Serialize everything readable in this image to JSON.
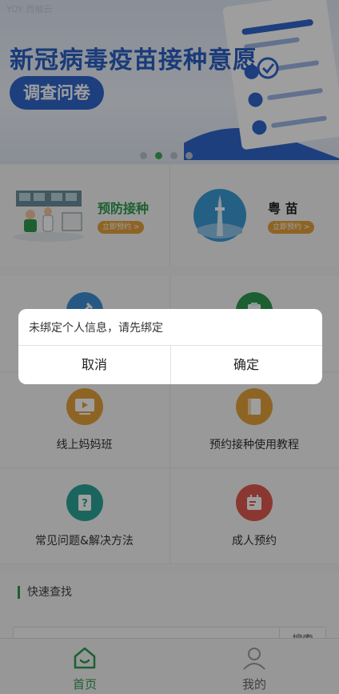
{
  "banner": {
    "watermark": "YOY 西柚云",
    "title": "新冠病毒疫苗接种意愿",
    "button_label": "调查问卷",
    "dots": 4,
    "active_dot": 1
  },
  "cards": [
    {
      "title": "预防接种",
      "tag": "立即预约 >"
    },
    {
      "title": "粤 苗",
      "tag": "立即预约 >"
    }
  ],
  "grid": [
    {
      "label": "",
      "icon": "syringe-icon",
      "color": "#3e8fd6"
    },
    {
      "label": "",
      "icon": "clipboard-icon",
      "color": "#2e9b50"
    },
    {
      "label": "线上妈妈班",
      "icon": "video-play-icon",
      "color": "#e6a23c"
    },
    {
      "label": "预约接种使用教程",
      "icon": "book-icon",
      "color": "#e6a23c"
    },
    {
      "label": "常见问题&解决方法",
      "icon": "question-doc-icon",
      "color": "#2aa59a"
    },
    {
      "label": "成人预约",
      "icon": "calendar-icon",
      "color": "#e05a4f"
    }
  ],
  "quick_search": {
    "title": "快速查找",
    "button_label": "搜索"
  },
  "tabbar": {
    "home_label": "首页",
    "mine_label": "我的",
    "active_color": "#2e9b50"
  },
  "dialog": {
    "message": "未绑定个人信息，请先绑定",
    "cancel_label": "取消",
    "confirm_label": "确定"
  }
}
